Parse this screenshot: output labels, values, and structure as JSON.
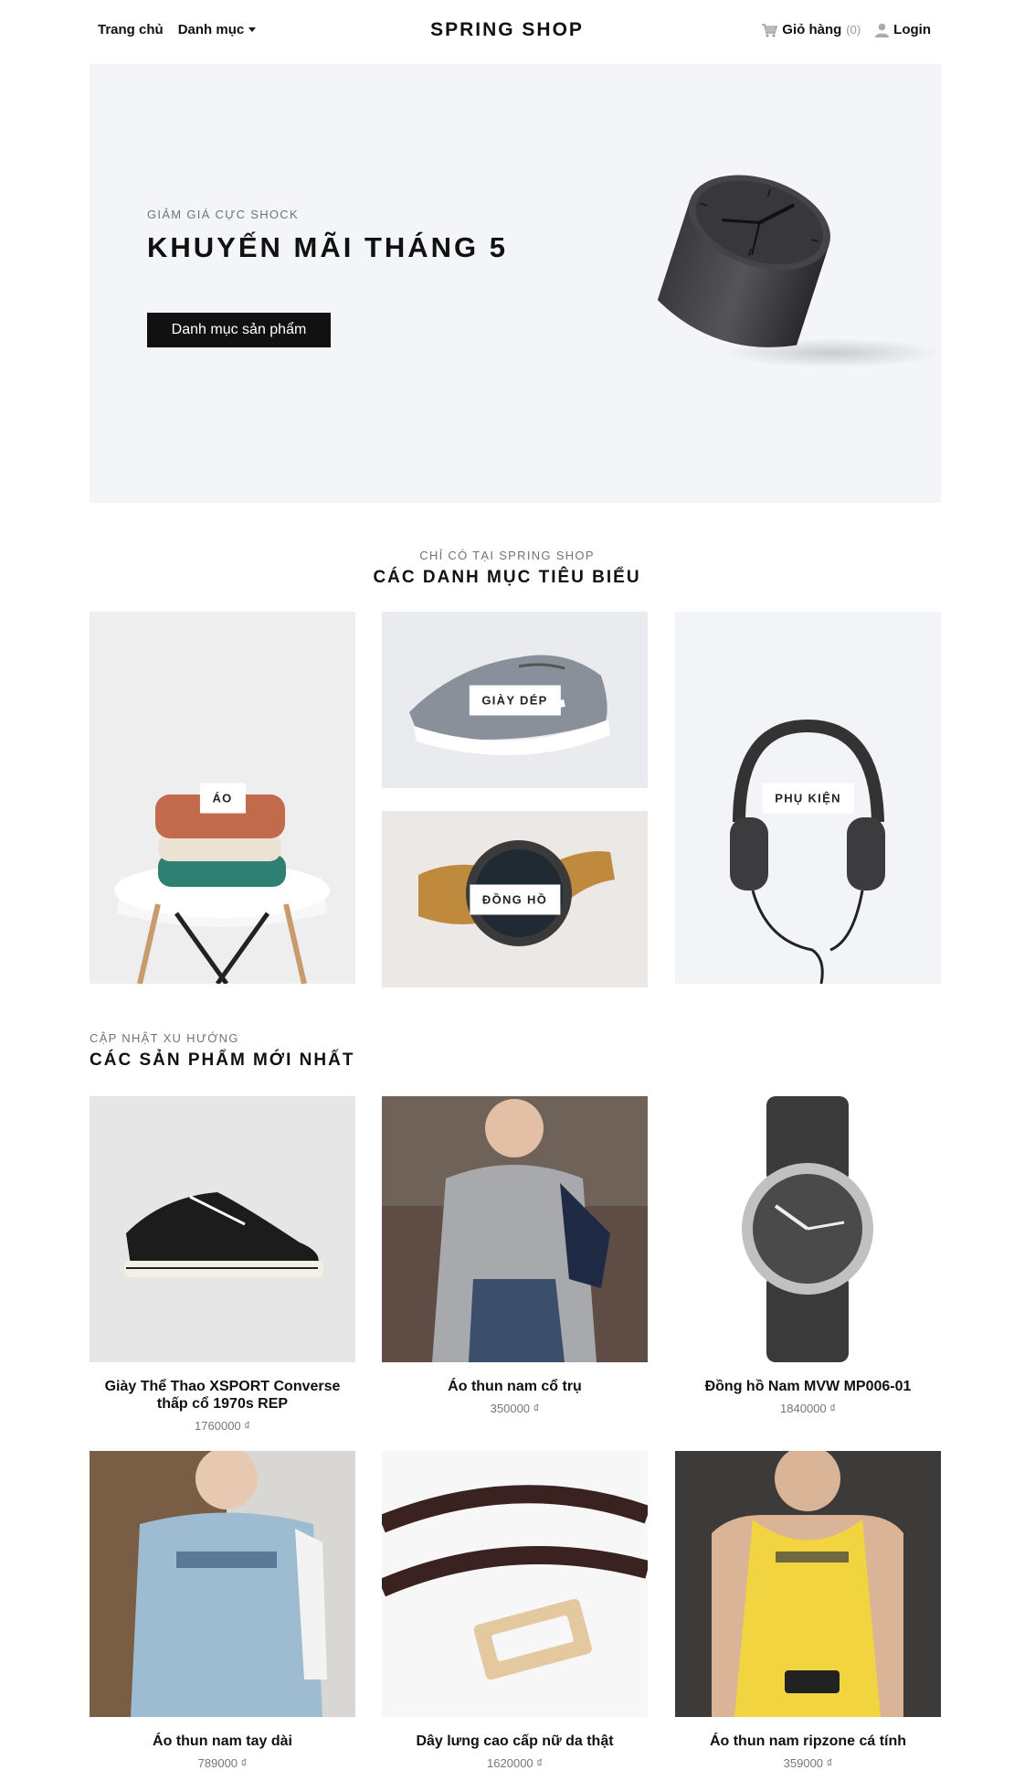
{
  "nav": {
    "home": "Trang chủ",
    "category": "Danh mục",
    "brand": "SPRING SHOP",
    "cart": "Giỏ hàng",
    "cart_count": "(0)",
    "login": "Login"
  },
  "hero": {
    "subtitle": "GIẢM GIÁ CỰC SHOCK",
    "title": "KHUYẾN MÃI THÁNG 5",
    "button": "Danh mục sản phẩm"
  },
  "categories_section": {
    "subtitle": "CHỈ CÓ TẠI SPRING SHOP",
    "title": "CÁC DANH MỤC TIÊU BIỂU",
    "items": [
      {
        "label": "ÁO",
        "icon": "sweater-stack-image"
      },
      {
        "label": "GIÀY DÉP",
        "icon": "sneaker-image"
      },
      {
        "label": "ĐỒNG HỒ",
        "icon": "wristwatch-image"
      },
      {
        "label": "PHỤ KIỆN",
        "icon": "headphones-image"
      }
    ]
  },
  "products_section": {
    "subtitle": "CẬP NHẬT XU HƯỚNG",
    "title": "CÁC SẢN PHẨM MỚI NHẤT",
    "items": [
      {
        "name": "Giày Thể Thao XSPORT Converse thấp cổ 1970s REP",
        "price": "1760000 ₫"
      },
      {
        "name": "Áo thun nam cổ trụ",
        "price": "350000 ₫"
      },
      {
        "name": "Đồng hồ Nam MVW MP006-01",
        "price": "1840000 ₫"
      },
      {
        "name": "Áo thun nam tay dài",
        "price": "789000 ₫"
      },
      {
        "name": "Dây lưng cao cấp nữ da thật",
        "price": "1620000 ₫"
      },
      {
        "name": "Áo thun nam ripzone cá tính",
        "price": "359000 ₫"
      }
    ]
  },
  "colors": {
    "hero_bg": "#f4f5f8",
    "button_bg": "#111111",
    "muted_text": "#6c757d"
  }
}
